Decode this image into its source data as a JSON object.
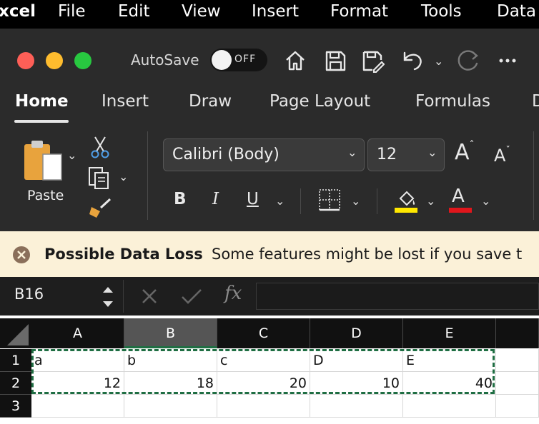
{
  "menubar": {
    "items": [
      {
        "label": "xcel"
      },
      {
        "label": "File"
      },
      {
        "label": "Edit"
      },
      {
        "label": "View"
      },
      {
        "label": "Insert"
      },
      {
        "label": "Format"
      },
      {
        "label": "Tools"
      },
      {
        "label": "Data"
      }
    ]
  },
  "titlebar": {
    "autosave_label": "AutoSave",
    "autosave_state": "OFF"
  },
  "ribbon": {
    "tabs": [
      {
        "label": "Home",
        "active": true
      },
      {
        "label": "Insert"
      },
      {
        "label": "Draw"
      },
      {
        "label": "Page Layout"
      },
      {
        "label": "Formulas"
      },
      {
        "label": "D"
      }
    ],
    "paste_label": "Paste",
    "font_name": "Calibri (Body)",
    "font_size": "12",
    "bold_label": "B",
    "italic_label": "I",
    "underline_label": "U",
    "highlight_color": "#ffe800",
    "font_color": "#e0161c"
  },
  "infobar": {
    "title": "Possible Data Loss",
    "message": "Some features might be lost if you save t"
  },
  "formula": {
    "name_box": "B16",
    "fx_label": "fx",
    "value": ""
  },
  "sheet": {
    "columns": [
      "A",
      "B",
      "C",
      "D",
      "E"
    ],
    "rows": [
      "1",
      "2",
      "3"
    ],
    "selected_column": "B",
    "copy_range_color": "#1f6e43",
    "data": [
      [
        "a",
        "b",
        "c",
        "D",
        "E"
      ],
      [
        "12",
        "18",
        "20",
        "10",
        "40"
      ]
    ]
  }
}
